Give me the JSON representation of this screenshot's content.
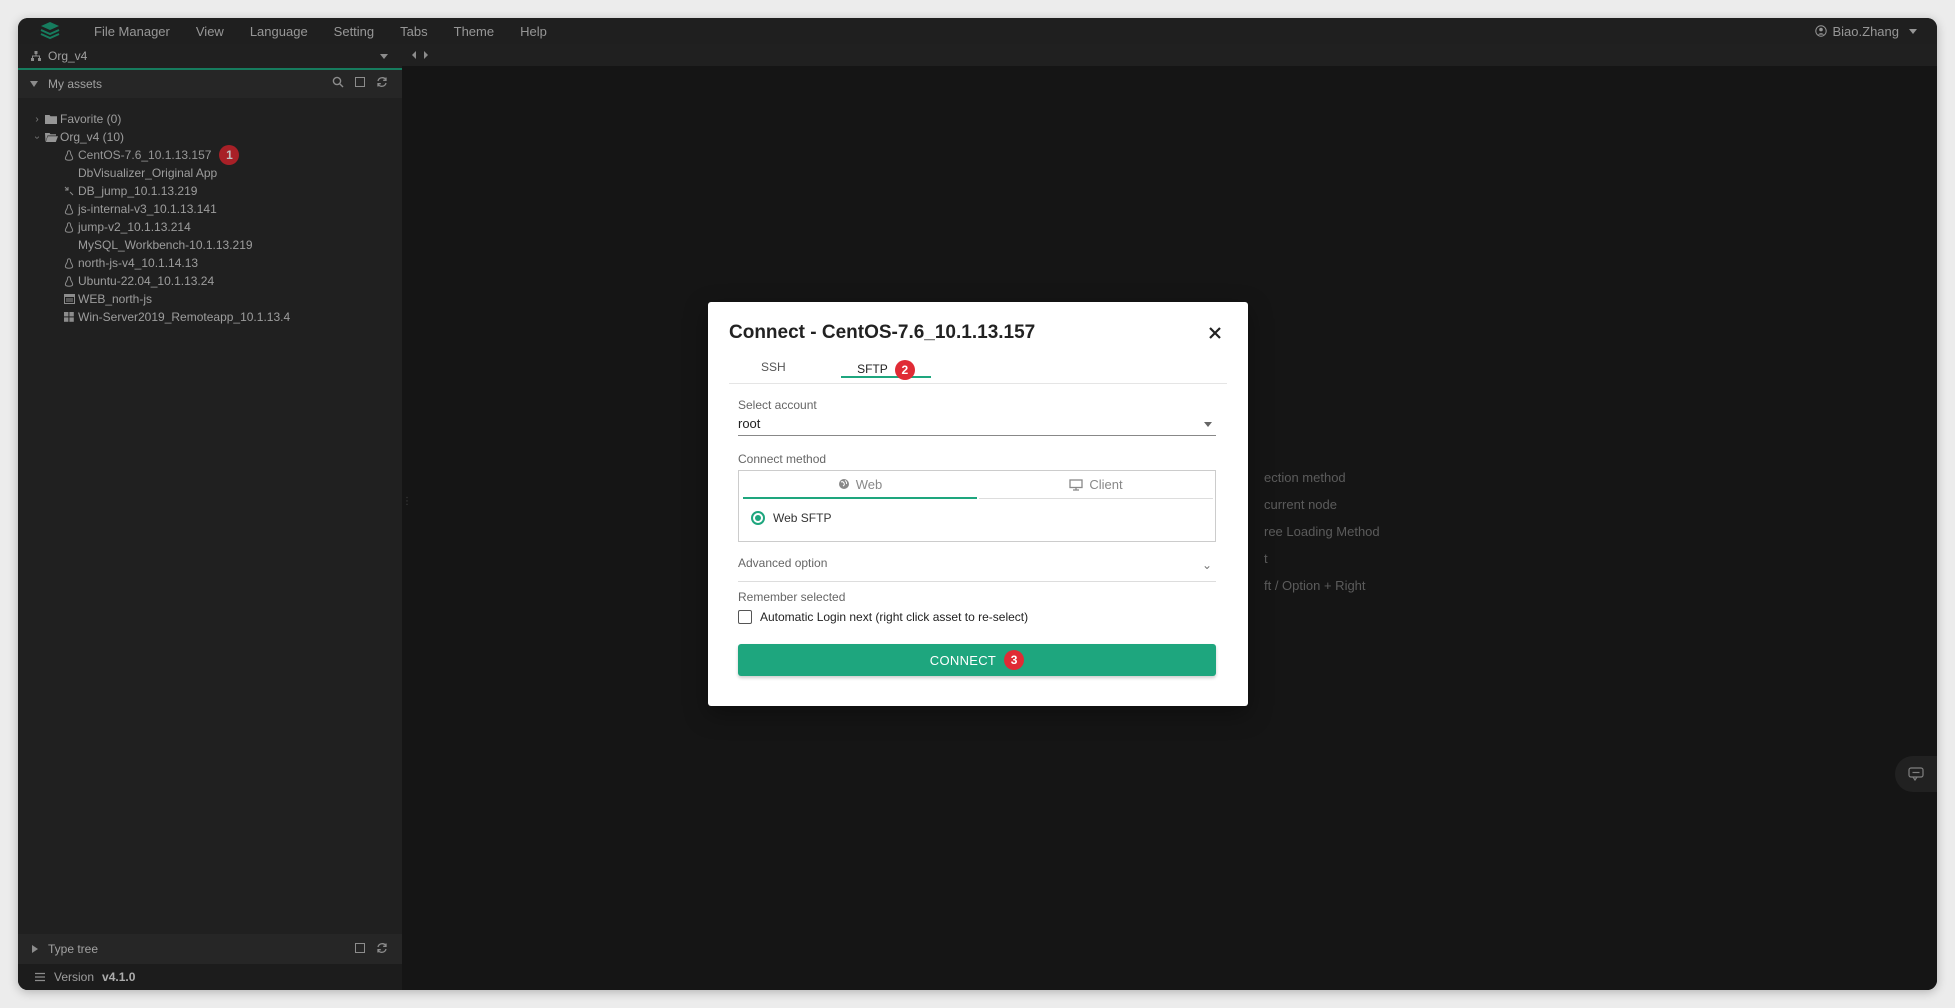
{
  "menubar": {
    "items": [
      "File Manager",
      "View",
      "Language",
      "Setting",
      "Tabs",
      "Theme",
      "Help"
    ],
    "user": "Biao.Zhang"
  },
  "sidebar": {
    "org": "Org_v4",
    "assets_title": "My assets",
    "tree": {
      "favorite": "Favorite (0)",
      "org_node": "Org_v4 (10)",
      "assets": [
        {
          "label": "CentOS-7.6_10.1.13.157",
          "icon": "linux-icon",
          "badge": "1"
        },
        {
          "label": "DbVisualizer_Original App",
          "icon": "none"
        },
        {
          "label": "DB_jump_10.1.13.219",
          "icon": "database-icon"
        },
        {
          "label": "js-internal-v3_10.1.13.141",
          "icon": "linux-icon"
        },
        {
          "label": "jump-v2_10.1.13.214",
          "icon": "linux-icon"
        },
        {
          "label": "MySQL_Workbench-10.1.13.219",
          "icon": "none"
        },
        {
          "label": "north-js-v4_10.1.14.13",
          "icon": "linux-icon"
        },
        {
          "label": "Ubuntu-22.04_10.1.13.24",
          "icon": "linux-icon"
        },
        {
          "label": "WEB_north-js",
          "icon": "web-icon"
        },
        {
          "label": "Win-Server2019_Remoteapp_10.1.13.4",
          "icon": "windows-icon"
        }
      ]
    },
    "type_tree": "Type tree",
    "version_label": "Version",
    "version_value": "v4.1.0"
  },
  "main": {
    "help_lines": [
      "ection method",
      "current node",
      "ree Loading Method",
      "t",
      "ft / Option + Right"
    ]
  },
  "modal": {
    "title": "Connect - CentOS-7.6_10.1.13.157",
    "tabs": {
      "ssh": "SSH",
      "sftp": "SFTP",
      "sftp_badge": "2"
    },
    "select_account_label": "Select account",
    "account_value": "root",
    "connect_method_label": "Connect method",
    "method_web": "Web",
    "method_client": "Client",
    "web_sftp": "Web SFTP",
    "advanced_option": "Advanced option",
    "remember_label": "Remember selected",
    "auto_login": "Automatic Login next (right click asset to re-select)",
    "connect_button": "CONNECT",
    "connect_badge": "3"
  },
  "colors": {
    "accent": "#1ea67e",
    "badge": "#e02b35",
    "sidebar_bg": "#2b2b2b",
    "main_bg": "#1c1c1c"
  }
}
